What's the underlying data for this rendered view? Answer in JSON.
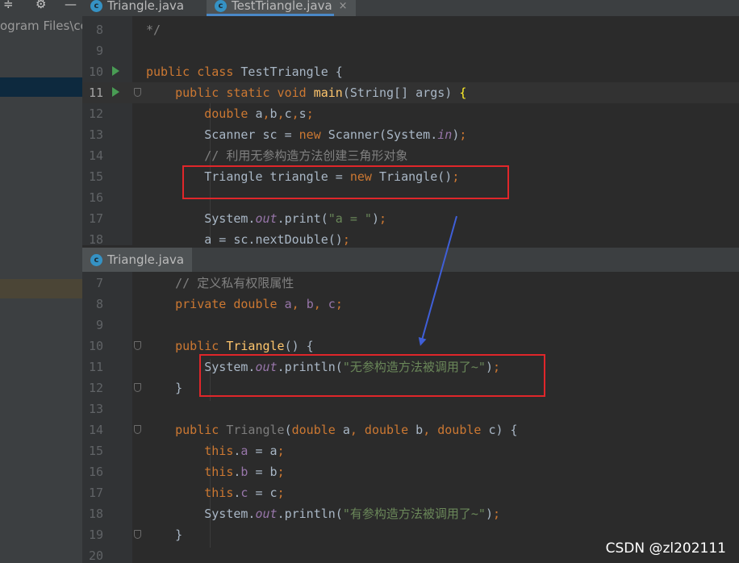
{
  "project_panel": {
    "path_text": "ogram Files\\co"
  },
  "top_tabs": [
    {
      "label": "Triangle.java",
      "icon": "class-icon",
      "icon_letter": "c"
    },
    {
      "label": "TestTriangle.java",
      "icon": "class-icon",
      "icon_letter": "c",
      "close": "×"
    }
  ],
  "bottom_tab": {
    "label": "Triangle.java",
    "icon": "class-icon",
    "icon_letter": "c"
  },
  "top_editor": {
    "lines": [
      {
        "num": "8",
        "text": "*/"
      },
      {
        "num": "9",
        "text": ""
      },
      {
        "num": "10",
        "text": "public class TestTriangle {"
      },
      {
        "num": "11",
        "text": "    public static void main(String[] args) {"
      },
      {
        "num": "12",
        "text": "        double a,b,c,s;"
      },
      {
        "num": "13",
        "text": "        Scanner sc = new Scanner(System.in);"
      },
      {
        "num": "14",
        "text": "        // 利用无参构造方法创建三角形对象"
      },
      {
        "num": "15",
        "text": "        Triangle triangle = new Triangle();"
      },
      {
        "num": "16",
        "text": ""
      },
      {
        "num": "17",
        "text": "        System.out.print(\"a = \");"
      },
      {
        "num": "18",
        "text": "        a = sc.nextDouble();"
      }
    ]
  },
  "bottom_editor": {
    "lines": [
      {
        "num": "7",
        "text": "    // 定义私有权限属性"
      },
      {
        "num": "8",
        "text": "    private double a, b, c;"
      },
      {
        "num": "9",
        "text": ""
      },
      {
        "num": "10",
        "text": "    public Triangle() {"
      },
      {
        "num": "11",
        "text": "        System.out.println(\"无参构造方法被调用了~\");"
      },
      {
        "num": "12",
        "text": "    }"
      },
      {
        "num": "13",
        "text": ""
      },
      {
        "num": "14",
        "text": "    public Triangle(double a, double b, double c) {"
      },
      {
        "num": "15",
        "text": "        this.a = a;"
      },
      {
        "num": "16",
        "text": "        this.b = b;"
      },
      {
        "num": "17",
        "text": "        this.c = c;"
      },
      {
        "num": "18",
        "text": "        System.out.println(\"有参构造方法被调用了~\");"
      },
      {
        "num": "19",
        "text": "    }"
      },
      {
        "num": "20",
        "text": ""
      }
    ]
  },
  "watermark": "CSDN @zl202111",
  "colors": {
    "keyword": "#cc7832",
    "string": "#6a8759",
    "comment": "#808080",
    "field": "#9876aa",
    "method_decl": "#ffc66d",
    "annotation_box": "#e0262a",
    "arrow": "#3f5fd8"
  }
}
